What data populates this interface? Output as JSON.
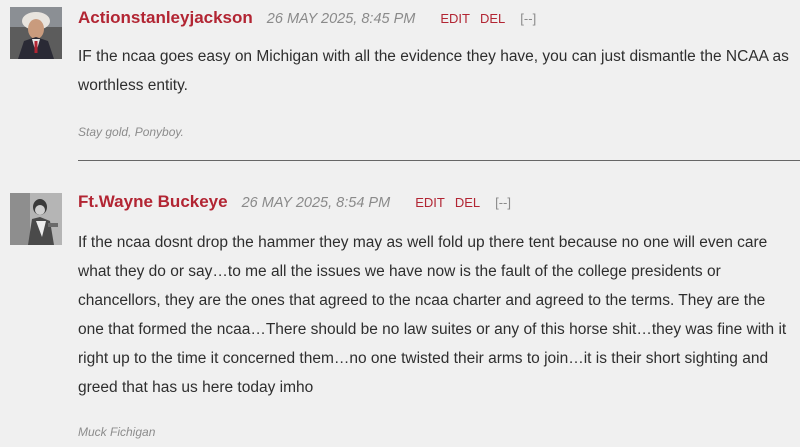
{
  "comments": [
    {
      "author": "Actionstanleyjackson",
      "date": "26 MAY 2025, 8:45 PM",
      "edit_label": "EDIT",
      "delete_label": "DEL",
      "collapse_label": "[--]",
      "body": "IF the ncaa goes easy on Michigan with all the evidence they have, you can just dismantle the NCAA as worthless entity.",
      "signature": "Stay gold, Ponyboy."
    },
    {
      "author": "Ft.Wayne Buckeye",
      "date": "26 MAY 2025, 8:54 PM",
      "edit_label": "EDIT",
      "delete_label": "DEL",
      "collapse_label": "[--]",
      "body": "If the ncaa dosnt drop the hammer they may as well fold up there tent because no one will even care what they do or say…to me all the issues we have now is the fault of the college presidents or chancellors, they are the ones that agreed to the ncaa charter  and agreed to the terms. They are the one that formed the ncaa…There should be no law suites or any of this horse shit…they was fine with it right up to the time it concerned them…no one twisted their arms to join…it is their short sighting and greed that has us here today imho",
      "signature": "Muck Fichigan"
    }
  ],
  "colors": {
    "accent": "#b22533",
    "background": "#f0f0f0",
    "muted": "#8a8a8a"
  }
}
